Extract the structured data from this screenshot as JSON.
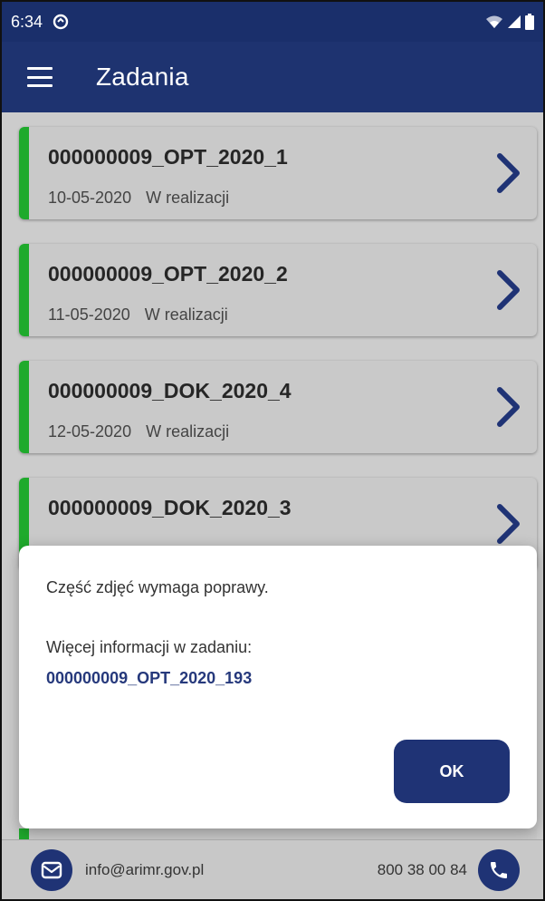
{
  "status_bar": {
    "time": "6:34",
    "icons": [
      "data-saver-icon",
      "wifi-icon",
      "signal-icon",
      "battery-icon"
    ]
  },
  "app_bar": {
    "title": "Zadania",
    "menu_icon": "hamburger-menu-icon"
  },
  "tasks": [
    {
      "code": "000000009_OPT_2020_1",
      "date": "10-05-2020",
      "status": "W realizacji"
    },
    {
      "code": "000000009_OPT_2020_2",
      "date": "11-05-2020",
      "status": "W realizacji"
    },
    {
      "code": "000000009_DOK_2020_4",
      "date": "12-05-2020",
      "status": "W realizacji"
    },
    {
      "code": "000000009_DOK_2020_3",
      "date": "",
      "status": ""
    }
  ],
  "dialog": {
    "message": "Część zdjęć wymaga poprawy.",
    "more_info": "Więcej informacji w zadaniu:",
    "task_link": "000000009_OPT_2020_193",
    "ok_label": "OK"
  },
  "footer": {
    "email": "info@arimr.gov.pl",
    "phone": "800 38 00 84"
  },
  "colors": {
    "primary": "#1e3370",
    "accent_green": "#1faa2c",
    "background": "#cccccc"
  }
}
